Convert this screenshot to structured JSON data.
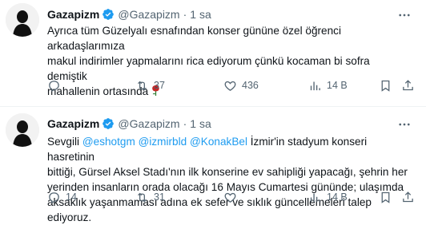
{
  "tweets": [
    {
      "name": "Gazapizm",
      "handle": "@Gazapizm",
      "dot": "·",
      "time": "1 sa",
      "lines": [
        "Ayrıca tüm Güzelyalı esnafından konser gününe özel öğrenci arkadaşlarımıza",
        "makul indirimler yapmalarını rica ediyorum çünkü kocaman bi sofra demiştik",
        "mahallenin ortasında"
      ],
      "emoji_icon": "rose-icon",
      "stats": {
        "replies": "",
        "retweets": "37",
        "likes": "436",
        "views": "14 B"
      }
    },
    {
      "name": "Gazapizm",
      "handle": "@Gazapizm",
      "dot": "·",
      "time": "1 sa",
      "line1_prefix": "Sevgili ",
      "mentions": [
        "@eshotgm",
        "@izmirbld",
        "@KonakBel"
      ],
      "line1_suffix": " İzmir'in stadyum konseri hasretinin",
      "lines": [
        "bittiği, Gürsel Aksel Stadı'nın ilk konserine ev sahipliği yapacağı, şehrin her",
        "yerinden insanların orada olacağı 16 Mayıs Cumartesi gününde; ulaşımda",
        "aksaklık yaşanmaması adına ek sefer ve sıklık güncellemeleri talep ediyoruz."
      ],
      "stats": {
        "replies": "14",
        "retweets": "31",
        "likes": "",
        "views": "14 B"
      }
    }
  ],
  "colors": {
    "accent": "#1d9bf0",
    "muted": "#536471",
    "text": "#0f1419"
  }
}
